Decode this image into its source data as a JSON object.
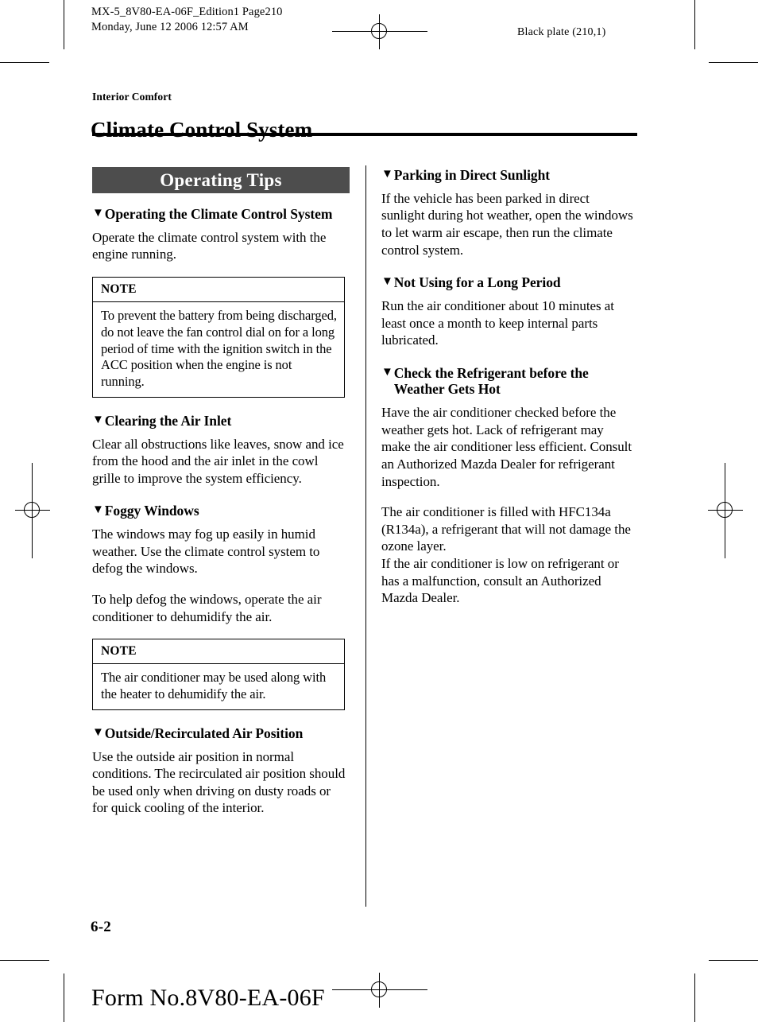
{
  "print_marks": {
    "job_info": "MX-5_8V80-EA-06F_Edition1 Page210\nMonday, June 12 2006 12:57 AM",
    "black_plate": "Black plate (210,1)"
  },
  "header": {
    "chapter_label": "Interior Comfort",
    "page_title": "Climate Control System"
  },
  "footer": {
    "folio": "6-2",
    "form_number": "Form No.8V80-EA-06F"
  },
  "icons": {
    "section_marker": "▼"
  },
  "colors": {
    "banner_background": "#4d4d4d",
    "banner_text": "#ffffff",
    "text": "#000000",
    "page_background": "#ffffff"
  },
  "left_column": {
    "banner": "Operating Tips",
    "sections": [
      {
        "heading": "Operating the Climate Control System",
        "paragraphs": [
          "Operate the climate control system with the engine running."
        ],
        "note": {
          "label": "NOTE",
          "text": "To prevent the battery from being discharged, do not leave the fan control dial on for a long period of time with the ignition switch in the ACC position when the engine is not running."
        }
      },
      {
        "heading": "Clearing the Air Inlet",
        "paragraphs": [
          "Clear all obstructions like leaves, snow and ice from the hood and the air inlet in the cowl grille to improve the system efficiency."
        ]
      },
      {
        "heading": "Foggy Windows",
        "paragraphs": [
          "The windows may fog up easily in humid weather. Use the climate control system to defog the windows.",
          "To help defog the windows, operate the air conditioner to dehumidify the air."
        ],
        "note": {
          "label": "NOTE",
          "text": "The air conditioner may be used along with the heater to dehumidify the air."
        }
      },
      {
        "heading": "Outside/Recirculated Air Position",
        "paragraphs": [
          "Use the outside air position in normal conditions. The recirculated air position should be used only when driving on dusty roads or for quick cooling of the interior."
        ]
      }
    ]
  },
  "right_column": {
    "sections": [
      {
        "heading": "Parking in Direct Sunlight",
        "paragraphs": [
          "If the vehicle has been parked in direct sunlight during hot weather, open the windows to let warm air escape, then run the climate control system."
        ]
      },
      {
        "heading": "Not Using for a Long Period",
        "paragraphs": [
          "Run the air conditioner about 10 minutes at least once a month to keep internal parts lubricated."
        ]
      },
      {
        "heading": "Check the Refrigerant before the Weather Gets Hot",
        "paragraphs": [
          "Have the air conditioner checked before the weather gets hot. Lack of refrigerant may make the air conditioner less efficient. Consult an Authorized Mazda Dealer for refrigerant inspection.",
          "The air conditioner is filled with HFC134a (R134a), a refrigerant that will not damage the ozone layer.\nIf the air conditioner is low on refrigerant or has a malfunction, consult an Authorized Mazda Dealer."
        ]
      }
    ]
  }
}
